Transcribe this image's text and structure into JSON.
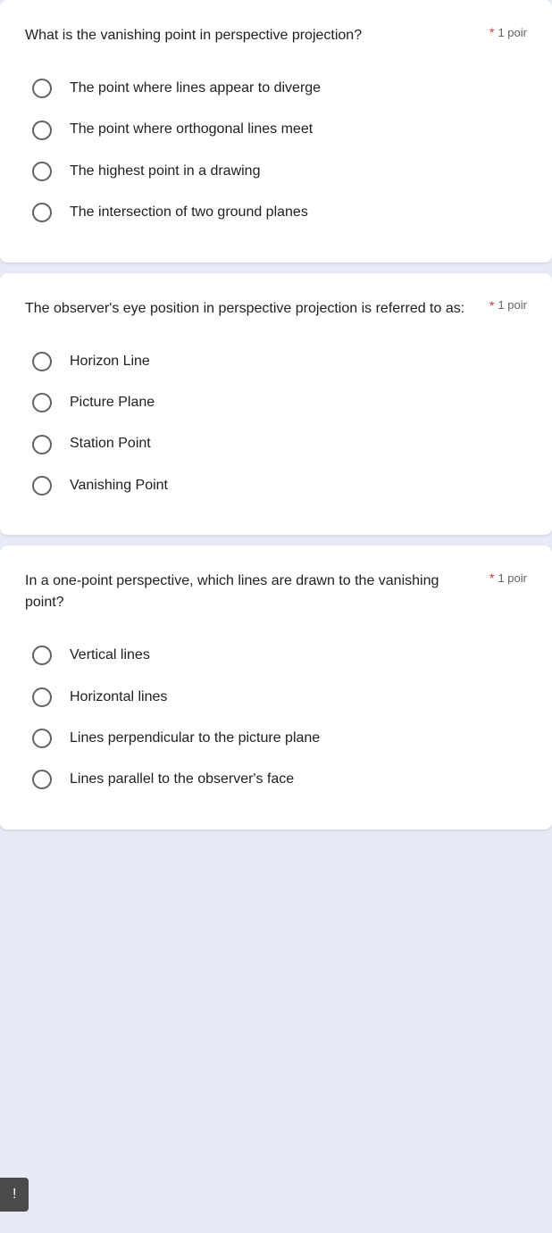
{
  "questions": [
    {
      "id": "q1",
      "text": "What is the vanishing point in perspective projection?",
      "required": true,
      "points_label": "1 poir",
      "options": [
        {
          "id": "q1a",
          "text": "The point where lines appear to diverge"
        },
        {
          "id": "q1b",
          "text": "The point where orthogonal lines meet"
        },
        {
          "id": "q1c",
          "text": "The highest point in a drawing"
        },
        {
          "id": "q1d",
          "text": "The intersection of two ground planes"
        }
      ]
    },
    {
      "id": "q2",
      "text": "The observer's eye position in perspective projection is referred to as:",
      "required": true,
      "points_label": "1 poir",
      "options": [
        {
          "id": "q2a",
          "text": "Horizon Line"
        },
        {
          "id": "q2b",
          "text": "Picture Plane"
        },
        {
          "id": "q2c",
          "text": "Station Point"
        },
        {
          "id": "q2d",
          "text": "Vanishing Point"
        }
      ]
    },
    {
      "id": "q3",
      "text": "In a one-point perspective, which lines are drawn to the vanishing point?",
      "required": true,
      "points_label": "1 poir",
      "options": [
        {
          "id": "q3a",
          "text": "Vertical lines"
        },
        {
          "id": "q3b",
          "text": "Horizontal lines"
        },
        {
          "id": "q3c",
          "text": "Lines perpendicular to the picture plane"
        },
        {
          "id": "q3d",
          "text": "Lines parallel to the observer's face"
        }
      ]
    }
  ],
  "feedback_button_label": "!",
  "required_symbol": "*"
}
